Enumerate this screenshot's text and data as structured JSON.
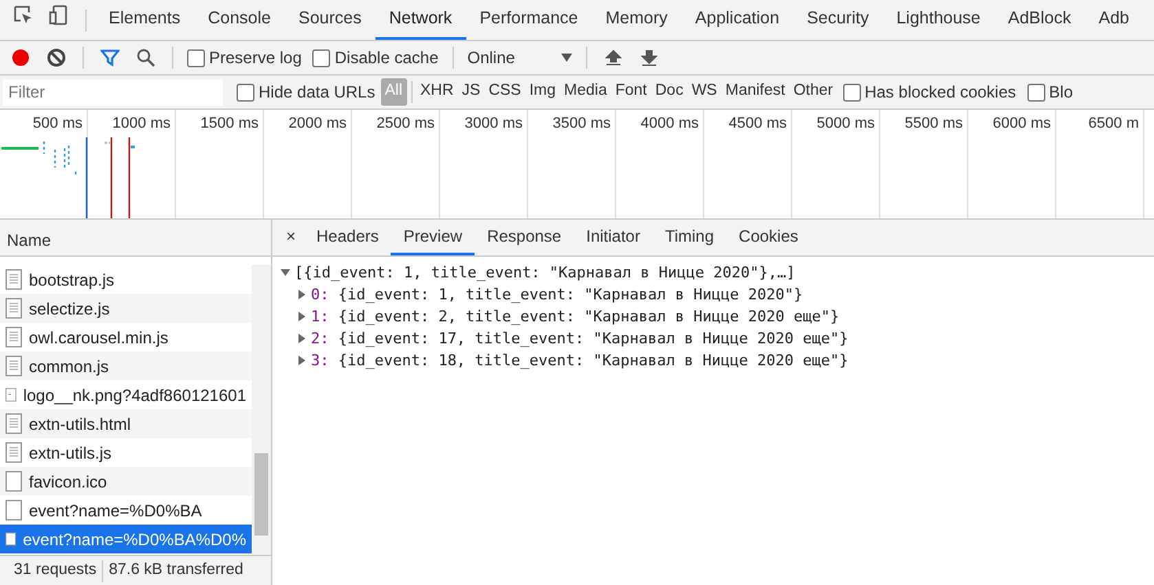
{
  "main_tabs": [
    {
      "label": "Elements",
      "selected": false
    },
    {
      "label": "Console",
      "selected": false
    },
    {
      "label": "Sources",
      "selected": false
    },
    {
      "label": "Network",
      "selected": true
    },
    {
      "label": "Performance",
      "selected": false
    },
    {
      "label": "Memory",
      "selected": false
    },
    {
      "label": "Application",
      "selected": false
    },
    {
      "label": "Security",
      "selected": false
    },
    {
      "label": "Lighthouse",
      "selected": false
    },
    {
      "label": "AdBlock",
      "selected": false
    },
    {
      "label": "Adb",
      "selected": false
    }
  ],
  "toolbar": {
    "recording": true,
    "preserve_log": {
      "label": "Preserve log",
      "checked": false
    },
    "disable_cache": {
      "label": "Disable cache",
      "checked": false
    },
    "throttling": "Online"
  },
  "filter_bar": {
    "placeholder": "Filter",
    "hide_data_urls": {
      "label": "Hide data URLs",
      "checked": false
    },
    "types": [
      {
        "label": "All",
        "selected": true
      },
      {
        "label": "XHR",
        "selected": false
      },
      {
        "label": "JS",
        "selected": false
      },
      {
        "label": "CSS",
        "selected": false
      },
      {
        "label": "Img",
        "selected": false
      },
      {
        "label": "Media",
        "selected": false
      },
      {
        "label": "Font",
        "selected": false
      },
      {
        "label": "Doc",
        "selected": false
      },
      {
        "label": "WS",
        "selected": false
      },
      {
        "label": "Manifest",
        "selected": false
      },
      {
        "label": "Other",
        "selected": false
      }
    ],
    "blocked_cookies": {
      "label": "Has blocked cookies",
      "checked": false
    },
    "blocked_requests": {
      "label": "Blo",
      "checked": false
    }
  },
  "overview": {
    "ticks": [
      "500 ms",
      "1000 ms",
      "1500 ms",
      "2000 ms",
      "2500 ms",
      "3000 ms",
      "3500 ms",
      "4000 ms",
      "4500 ms",
      "5000 ms",
      "5500 ms",
      "6000 ms",
      "6500 m"
    ]
  },
  "requests": {
    "column": "Name",
    "rows": [
      {
        "name": "bootstrap.js",
        "kind": "script",
        "selected": false
      },
      {
        "name": "selectize.js",
        "kind": "script",
        "selected": false
      },
      {
        "name": "owl.carousel.min.js",
        "kind": "script",
        "selected": false
      },
      {
        "name": "common.js",
        "kind": "script",
        "selected": false
      },
      {
        "name": "logo__nk.png?4adf860121601",
        "kind": "image",
        "selected": false
      },
      {
        "name": "extn-utils.html",
        "kind": "script",
        "selected": false
      },
      {
        "name": "extn-utils.js",
        "kind": "script",
        "selected": false
      },
      {
        "name": "favicon.ico",
        "kind": "blank",
        "selected": false
      },
      {
        "name": "event?name=%D0%BA",
        "kind": "blank",
        "selected": false
      },
      {
        "name": "event?name=%D0%BA%D0%",
        "kind": "blank",
        "selected": true
      }
    ]
  },
  "status_bar": [
    "31 requests",
    "87.6 kB transferred"
  ],
  "detail_tabs": {
    "close": "×",
    "tabs": [
      {
        "label": "Headers",
        "selected": false
      },
      {
        "label": "Preview",
        "selected": true
      },
      {
        "label": "Response",
        "selected": false
      },
      {
        "label": "Initiator",
        "selected": false
      },
      {
        "label": "Timing",
        "selected": false
      },
      {
        "label": "Cookies",
        "selected": false
      }
    ]
  },
  "preview": {
    "text": "[{id_event: 1, title_event: \"Карнавал в Ницце 2020\"},…]",
    "expanded": true,
    "children": [
      {
        "key": "0:",
        "text": "{id_event: 1, title_event: \"Карнавал в Ницце 2020\"}",
        "expanded": false
      },
      {
        "key": "1:",
        "text": "{id_event: 2, title_event: \"Карнавал в Ницце 2020 еще\"}",
        "expanded": false
      },
      {
        "key": "2:",
        "text": "{id_event: 17, title_event: \"Карнавал в Ницце 2020 еще\"}",
        "expanded": false
      },
      {
        "key": "3:",
        "text": "{id_event: 18, title_event: \"Карнавал в Ницце 2020 еще\"}",
        "expanded": false
      }
    ]
  }
}
